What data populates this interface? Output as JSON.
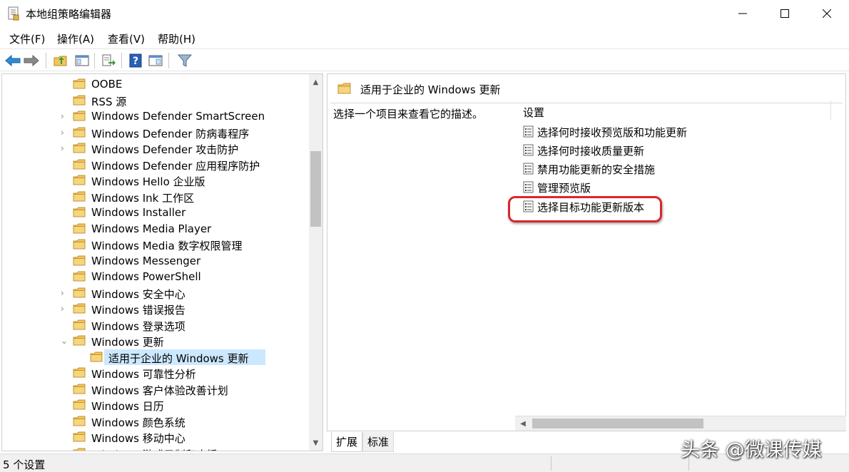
{
  "window": {
    "title": "本地组策略编辑器",
    "minimize_glyph": "—",
    "maximize_glyph": "☐",
    "close_glyph": "✕"
  },
  "menu": [
    {
      "label": "文件(F)"
    },
    {
      "label": "操作(A)"
    },
    {
      "label": "查看(V)"
    },
    {
      "label": "帮助(H)"
    }
  ],
  "toolbar": {
    "icons": [
      "back-arrow-icon",
      "forward-arrow-icon",
      "up-folder-icon",
      "show-hide-tree-icon",
      "export-list-icon",
      "help-icon",
      "properties-icon",
      "filter-icon"
    ]
  },
  "tree": {
    "items": [
      {
        "label": "OOBE",
        "expander": ""
      },
      {
        "label": "RSS 源",
        "expander": ""
      },
      {
        "label": "Windows Defender SmartScreen",
        "expander": "›"
      },
      {
        "label": "Windows Defender 防病毒程序",
        "expander": "›"
      },
      {
        "label": "Windows Defender 攻击防护",
        "expander": "›"
      },
      {
        "label": "Windows Defender 应用程序防护",
        "expander": ""
      },
      {
        "label": "Windows Hello 企业版",
        "expander": ""
      },
      {
        "label": "Windows Ink 工作区",
        "expander": ""
      },
      {
        "label": "Windows Installer",
        "expander": ""
      },
      {
        "label": "Windows Media Player",
        "expander": ""
      },
      {
        "label": "Windows Media 数字权限管理",
        "expander": ""
      },
      {
        "label": "Windows Messenger",
        "expander": ""
      },
      {
        "label": "Windows PowerShell",
        "expander": ""
      },
      {
        "label": "Windows 安全中心",
        "expander": "›"
      },
      {
        "label": "Windows 错误报告",
        "expander": "›"
      },
      {
        "label": "Windows 登录选项",
        "expander": ""
      },
      {
        "label": "Windows 更新",
        "expander": "⌄"
      },
      {
        "label": "适用于企业的 Windows 更新",
        "expander": "",
        "child": true,
        "selected": true
      },
      {
        "label": "Windows 可靠性分析",
        "expander": ""
      },
      {
        "label": "Windows 客户体验改善计划",
        "expander": ""
      },
      {
        "label": "Windows 日历",
        "expander": ""
      },
      {
        "label": "Windows 颜色系统",
        "expander": ""
      },
      {
        "label": "Windows 移动中心",
        "expander": ""
      },
      {
        "label": "Windows 游戏录制和广播",
        "expander": "",
        "clipped": true
      }
    ]
  },
  "details": {
    "folder_title": "适用于企业的 Windows 更新",
    "description": "选择一个项目来查看它的描述。",
    "column_header": "设置",
    "settings": [
      {
        "label": "选择何时接收预览版和功能更新"
      },
      {
        "label": "选择何时接收质量更新"
      },
      {
        "label": "禁用功能更新的安全措施"
      },
      {
        "label": "管理预览版"
      },
      {
        "label": "选择目标功能更新版本",
        "highlighted": true
      }
    ]
  },
  "tabs": [
    {
      "label": "扩展",
      "active": true
    },
    {
      "label": "标准",
      "active": false
    }
  ],
  "status": {
    "text": "5 个设置"
  },
  "watermark": {
    "text": "头条 @微课传媒"
  },
  "colors": {
    "selection": "#cce8ff",
    "highlight_ring": "#d9262c",
    "folder": "#f2c55c"
  }
}
